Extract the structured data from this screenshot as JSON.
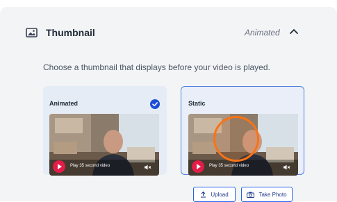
{
  "header": {
    "title": "Thumbnail",
    "status": "Animated",
    "icon": "image-icon",
    "toggle_icon": "chevron-up-icon"
  },
  "description": "Choose a thumbnail that displays before your video is played.",
  "options": [
    {
      "label": "Animated",
      "selected": true,
      "play_label": "Play 35 second video"
    },
    {
      "label": "Static",
      "selected": false,
      "play_label": "Play 35 second video"
    }
  ],
  "buttons": {
    "upload_label": "Upload",
    "take_photo_label": "Take Photo"
  },
  "colors": {
    "accent": "#1d4ed8",
    "selected_border": "#4d7fe0",
    "play": "#e11d48",
    "highlight_ring": "#f97316"
  }
}
